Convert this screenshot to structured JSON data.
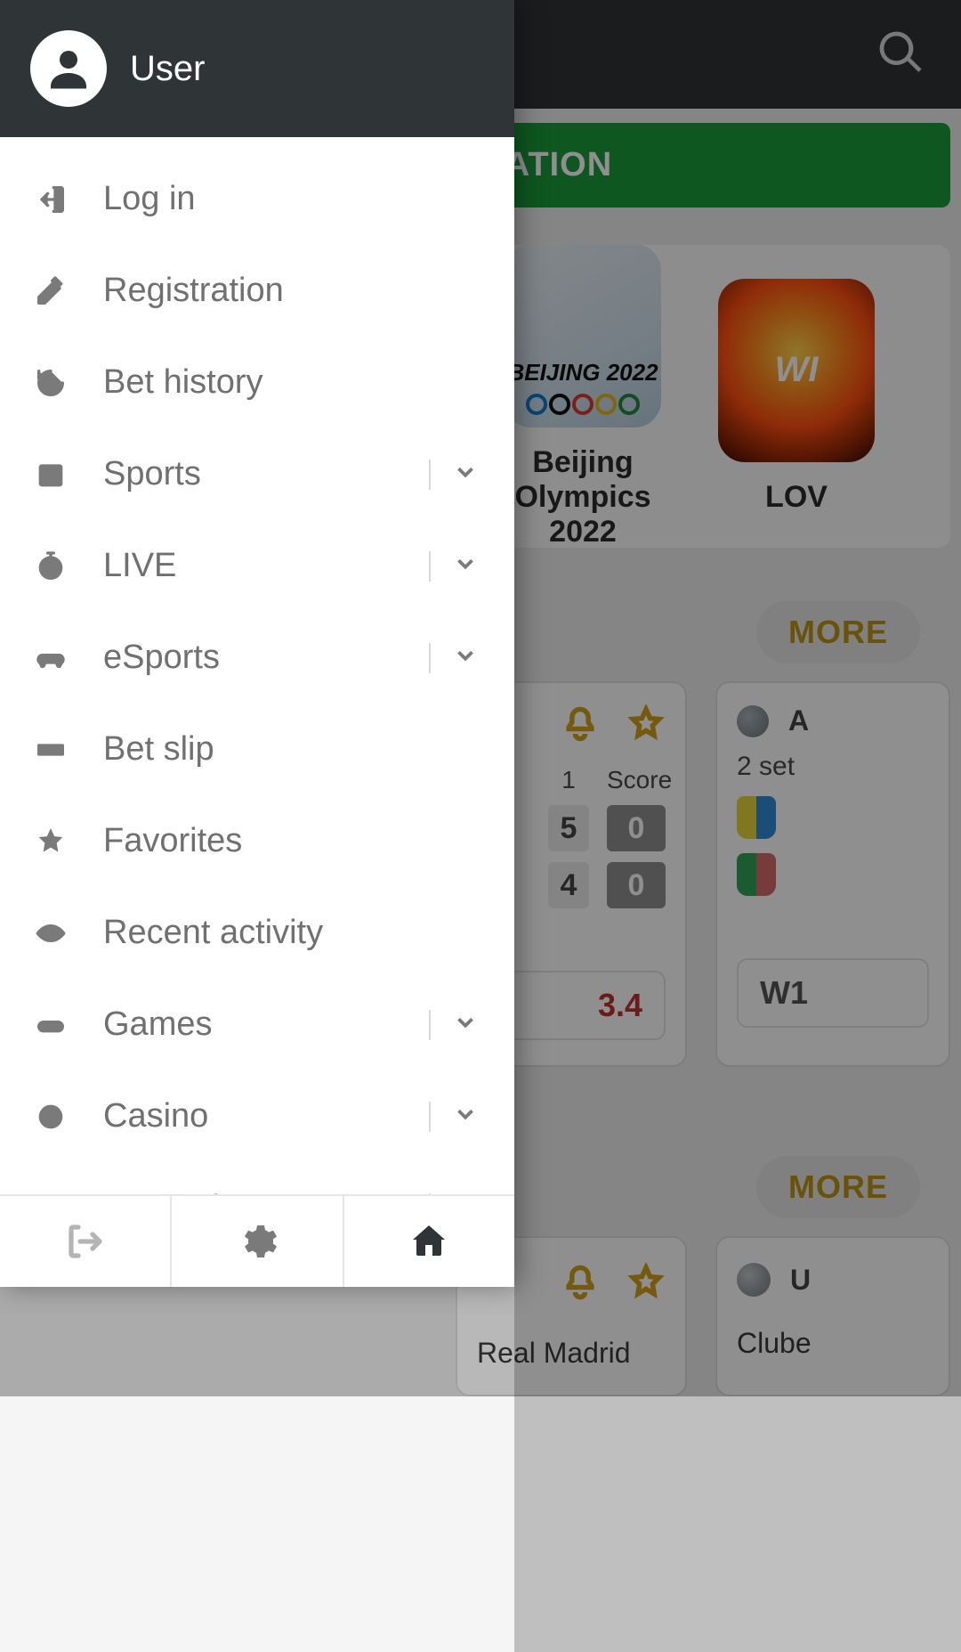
{
  "header": {
    "user_label": "User"
  },
  "menu": {
    "items": [
      {
        "label": "Log in",
        "icon": "login-icon",
        "expandable": false
      },
      {
        "label": "Registration",
        "icon": "edit-icon",
        "expandable": false
      },
      {
        "label": "Bet history",
        "icon": "history-icon",
        "expandable": false
      },
      {
        "label": "Sports",
        "icon": "calendar-icon",
        "expandable": true
      },
      {
        "label": "LIVE",
        "icon": "stopwatch-icon",
        "expandable": true
      },
      {
        "label": "eSports",
        "icon": "gamepad-icon",
        "expandable": true
      },
      {
        "label": "Bet slip",
        "icon": "ticket-icon",
        "expandable": false
      },
      {
        "label": "Favorites",
        "icon": "star-icon",
        "expandable": false
      },
      {
        "label": "Recent activity",
        "icon": "eye-icon",
        "expandable": false
      },
      {
        "label": "Games",
        "icon": "gamepad2-icon",
        "expandable": true
      },
      {
        "label": "Casino",
        "icon": "chip-icon",
        "expandable": true
      },
      {
        "label": "Promotions",
        "icon": "balloons-icon",
        "expandable": true
      }
    ]
  },
  "background": {
    "registration_button": "REGISTRATION",
    "promos": [
      {
        "tile_text": "BEIJING 2022",
        "label": "Beijing Olympics 2022"
      },
      {
        "tile_text": "WI",
        "label": "LOV"
      }
    ],
    "more_label": "MORE",
    "event1": {
      "col_period": "1",
      "col_score": "Score",
      "rows": [
        {
          "period": "5",
          "score": "0"
        },
        {
          "period": "4",
          "score": "0"
        }
      ],
      "odds_value": "3.4"
    },
    "event2": {
      "top_text": "A",
      "set_label": "2 set",
      "odds_label": "W1"
    },
    "event3": {
      "team": "Real Madrid"
    },
    "event4": {
      "top_text": "U",
      "team": "Clube"
    }
  }
}
